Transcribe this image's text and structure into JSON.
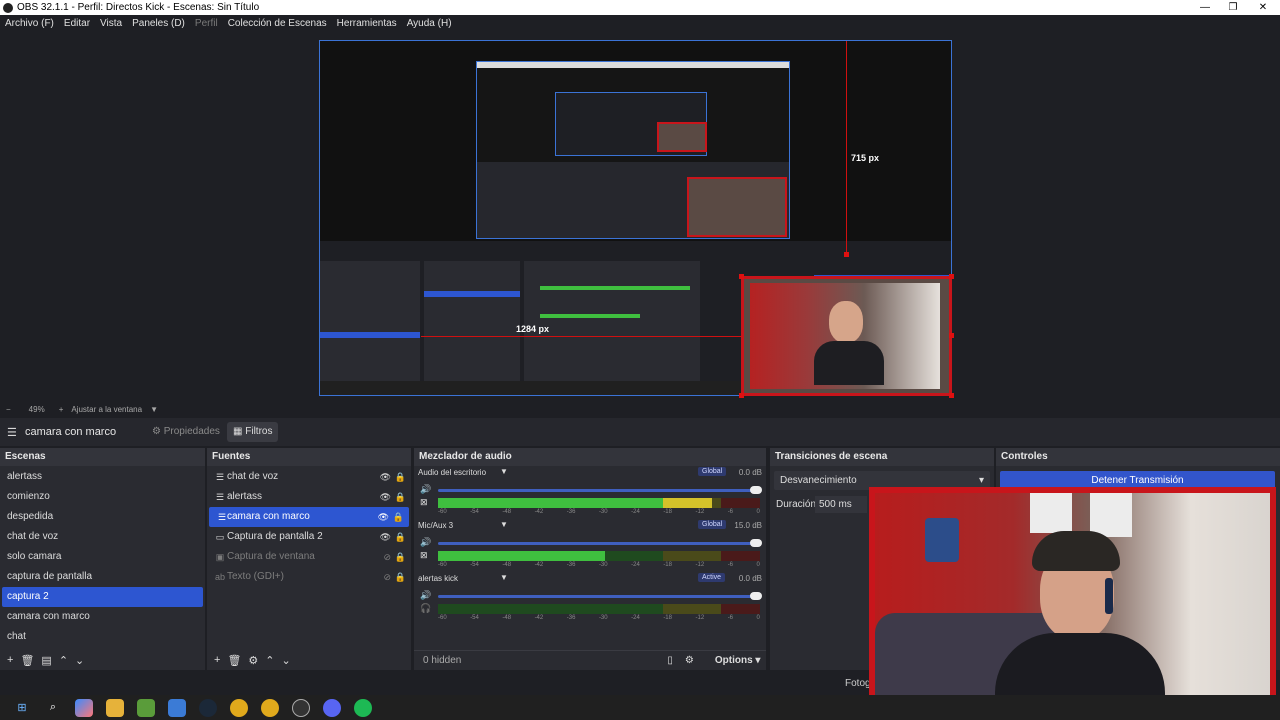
{
  "window": {
    "title": "OBS 32.1.1 - Perfil: Directos Kick - Escenas: Sin Título"
  },
  "menu": [
    "Archivo (F)",
    "Editar",
    "Vista",
    "Paneles (D)",
    "Perfil",
    "Colección de Escenas",
    "Herramientas",
    "Ayuda (H)"
  ],
  "preview": {
    "height_label": "715 px",
    "width_label": "1284 px"
  },
  "zoom": {
    "minus": "−",
    "value": "49%",
    "plus": "+",
    "fit_label": "Ajustar a la ventana"
  },
  "source_bar": {
    "selected_source": "camara con marco",
    "properties_tab": "Propiedades",
    "filters_tab": "Filtros"
  },
  "scenes": {
    "title": "Escenas",
    "items": [
      "alertass",
      "comienzo",
      "despedida",
      "chat de voz",
      "solo camara",
      "captura de pantalla",
      "captura 2",
      "camara con marco",
      "chat"
    ],
    "selected_index": 6
  },
  "sources": {
    "title": "Fuentes",
    "items": [
      {
        "name": "chat de voz",
        "icon": "list-icon"
      },
      {
        "name": "alertass",
        "icon": "list-icon"
      },
      {
        "name": "camara con marco",
        "icon": "list-icon"
      },
      {
        "name": "Captura de pantalla 2",
        "icon": "monitor-icon"
      },
      {
        "name": "Captura de ventana",
        "icon": "window-icon"
      },
      {
        "name": "Texto (GDI+)",
        "icon": "text-icon"
      }
    ]
  },
  "mixer": {
    "title": "Mezclador de audio",
    "channels": [
      {
        "name": "Audio del escritorio",
        "badge": "Global",
        "db": "0.0 dB",
        "level": 0.85
      },
      {
        "name": "Mic/Aux 3",
        "badge": "Global",
        "db": "15.0 dB",
        "level": 0.52
      },
      {
        "name": "alertas kick",
        "badge": "Active",
        "db": "0.0 dB",
        "level": 0.0
      }
    ],
    "ticks": [
      "-60",
      "-54",
      "-48",
      "-42",
      "-36",
      "-30",
      "-24",
      "-18",
      "-12",
      "-6",
      "0"
    ],
    "hidden_label": "0 hidden",
    "options_label": "Options"
  },
  "transitions": {
    "title": "Transiciones de escena",
    "selected": "Desvanecimiento",
    "duration_label": "Duración",
    "duration_value": "500 ms"
  },
  "controls": {
    "title": "Controles",
    "stop_stream": "Detener Transmisión"
  },
  "status": {
    "text": "Fotog"
  }
}
